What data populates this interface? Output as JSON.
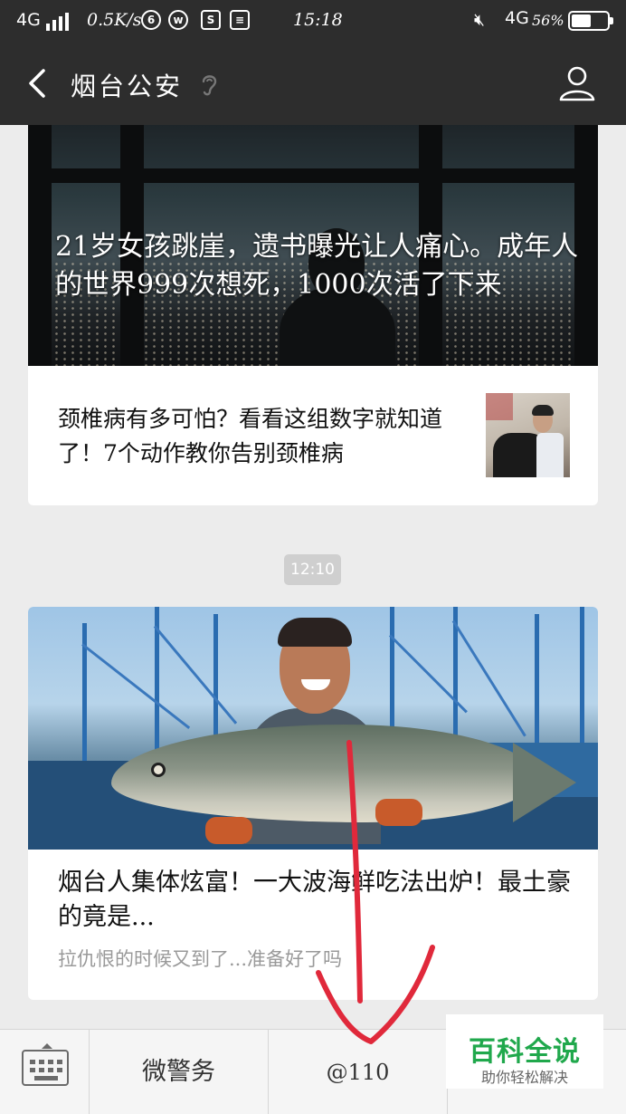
{
  "status_bar": {
    "network": "4G",
    "speed": "0.5K/s",
    "network_right": "4G",
    "battery_text": "56%",
    "battery_level": 0.56,
    "time": "15:18"
  },
  "title_bar": {
    "title": "烟台公安",
    "back_icon": "chevron-left-icon",
    "ear_icon": "ear-icon",
    "profile_icon": "person-icon"
  },
  "articles": [
    {
      "cover_title": "21岁女孩跳崖，遗书曝光让人痛心。成年人的世界999次想死，1000次活了下来",
      "sub_title": "颈椎病有多可怕？看看这组数字就知道了！7个动作教你告别颈椎病"
    },
    {
      "title": "烟台人集体炫富！一大波海鲜吃法出炉！最土豪的竟是...",
      "desc": "拉仇恨的时候又到了...准备好了吗"
    }
  ],
  "timestamp": "12:10",
  "menu": {
    "keyboard_icon": "keyboard-icon",
    "items": [
      "微警务",
      "@110",
      ""
    ]
  },
  "watermark": {
    "main": "百科全说",
    "sub": "助你轻松解决"
  },
  "colors": {
    "bar_bg": "#2d2d2d",
    "page_bg": "#ececec",
    "annotation": "#e0293b",
    "watermark_green": "#20a84c"
  }
}
